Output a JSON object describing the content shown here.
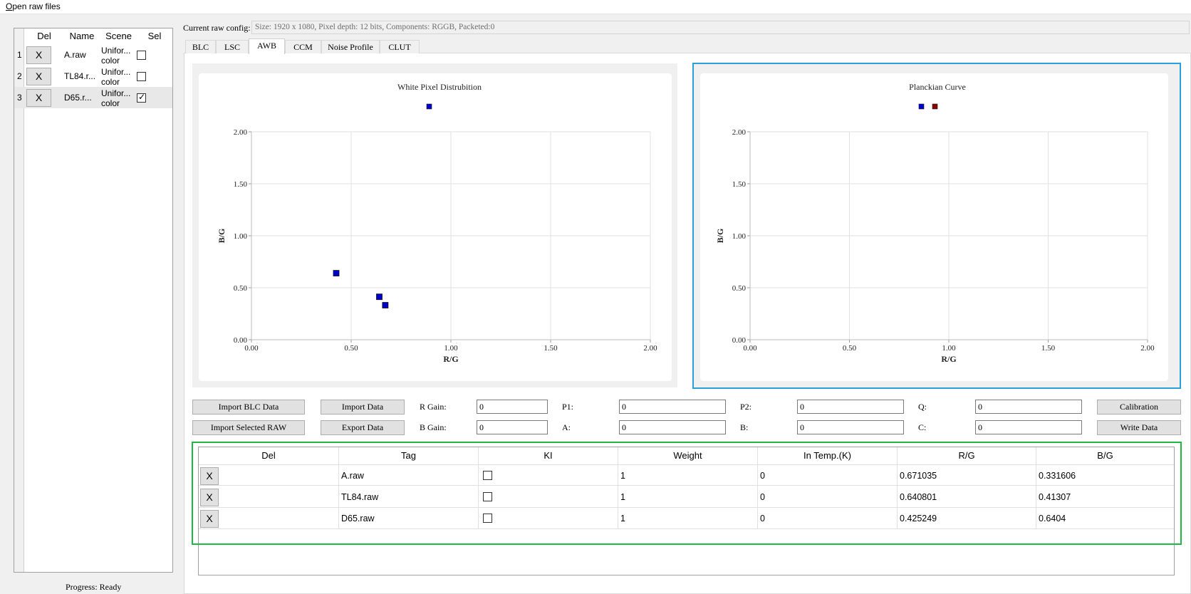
{
  "menu": {
    "open_raw_files": "Open raw files"
  },
  "file_grid": {
    "headers": [
      "Del",
      "Name",
      "Scene",
      "Sel"
    ],
    "rows": [
      {
        "num": "1",
        "del": "X",
        "name": "A.raw",
        "scene": "Unifor... color",
        "sel": false
      },
      {
        "num": "2",
        "del": "X",
        "name": "TL84.r...",
        "scene": "Unifor... color",
        "sel": false
      },
      {
        "num": "3",
        "del": "X",
        "name": "D65.r...",
        "scene": "Unifor... color",
        "sel": true
      }
    ]
  },
  "progress": "Progress: Ready",
  "raw_config": {
    "label": "Current raw config:",
    "value": "Size: 1920 x 1080, Pixel depth: 12 bits, Components: RGGB, Packeted:0"
  },
  "tabs": [
    {
      "label": "BLC",
      "active": false
    },
    {
      "label": "LSC",
      "active": false
    },
    {
      "label": "AWB",
      "active": true
    },
    {
      "label": "CCM",
      "active": false
    },
    {
      "label": "Noise Profile",
      "active": false
    },
    {
      "label": "CLUT",
      "active": false
    }
  ],
  "chart_data": [
    {
      "type": "scatter",
      "title": "White Pixel Distrubition",
      "xlabel": "R/G",
      "ylabel": "B/G",
      "xlim": [
        0,
        2
      ],
      "ylim": [
        0,
        2
      ],
      "xticks": [
        "0.00",
        "0.50",
        "1.00",
        "1.50",
        "2.00"
      ],
      "yticks": [
        "0.00",
        "0.50",
        "1.00",
        "1.50",
        "2.00"
      ],
      "grid": true,
      "legend_color": "#0000cc",
      "points": [
        {
          "x": 0.425,
          "y": 0.64
        },
        {
          "x": 0.641,
          "y": 0.413
        },
        {
          "x": 0.671,
          "y": 0.332
        }
      ]
    },
    {
      "type": "scatter",
      "title": "Planckian Curve",
      "xlabel": "R/G",
      "ylabel": "B/G",
      "xlim": [
        0,
        2
      ],
      "ylim": [
        0,
        2
      ],
      "xticks": [
        "0.00",
        "0.50",
        "1.00",
        "1.50",
        "2.00"
      ],
      "yticks": [
        "0.00",
        "0.50",
        "1.00",
        "1.50",
        "2.00"
      ],
      "grid": true,
      "legend_colors": [
        "#0000cc",
        "#8b0000"
      ],
      "points": []
    }
  ],
  "buttons": {
    "import_blc": "Import BLC Data",
    "import_selected_raw": "Import Selected RAW",
    "import_data": "Import Data",
    "export_data": "Export Data",
    "calibration": "Calibration",
    "write_data": "Write Data"
  },
  "params": {
    "r_gain": {
      "label": "R Gain:",
      "value": "0"
    },
    "b_gain": {
      "label": "B Gain:",
      "value": "0"
    },
    "p1": {
      "label": "P1:",
      "value": "0"
    },
    "a": {
      "label": "A:",
      "value": "0"
    },
    "p2": {
      "label": "P2:",
      "value": "0"
    },
    "b": {
      "label": "B:",
      "value": "0"
    },
    "q": {
      "label": "Q:",
      "value": "0"
    },
    "c": {
      "label": "C:",
      "value": "0"
    }
  },
  "data_grid": {
    "headers": [
      "Del",
      "Tag",
      "KI",
      "Weight",
      "In Temp.(K)",
      "R/G",
      "B/G"
    ],
    "rows": [
      {
        "del": "X",
        "tag": "A.raw",
        "ki": false,
        "weight": "1",
        "temp": "0",
        "rg": "0.671035",
        "bg": "0.331606"
      },
      {
        "del": "X",
        "tag": "TL84.raw",
        "ki": false,
        "weight": "1",
        "temp": "0",
        "rg": "0.640801",
        "bg": "0.41307"
      },
      {
        "del": "X",
        "tag": "D65.raw",
        "ki": false,
        "weight": "1",
        "temp": "0",
        "rg": "0.425249",
        "bg": "0.6404"
      }
    ]
  }
}
